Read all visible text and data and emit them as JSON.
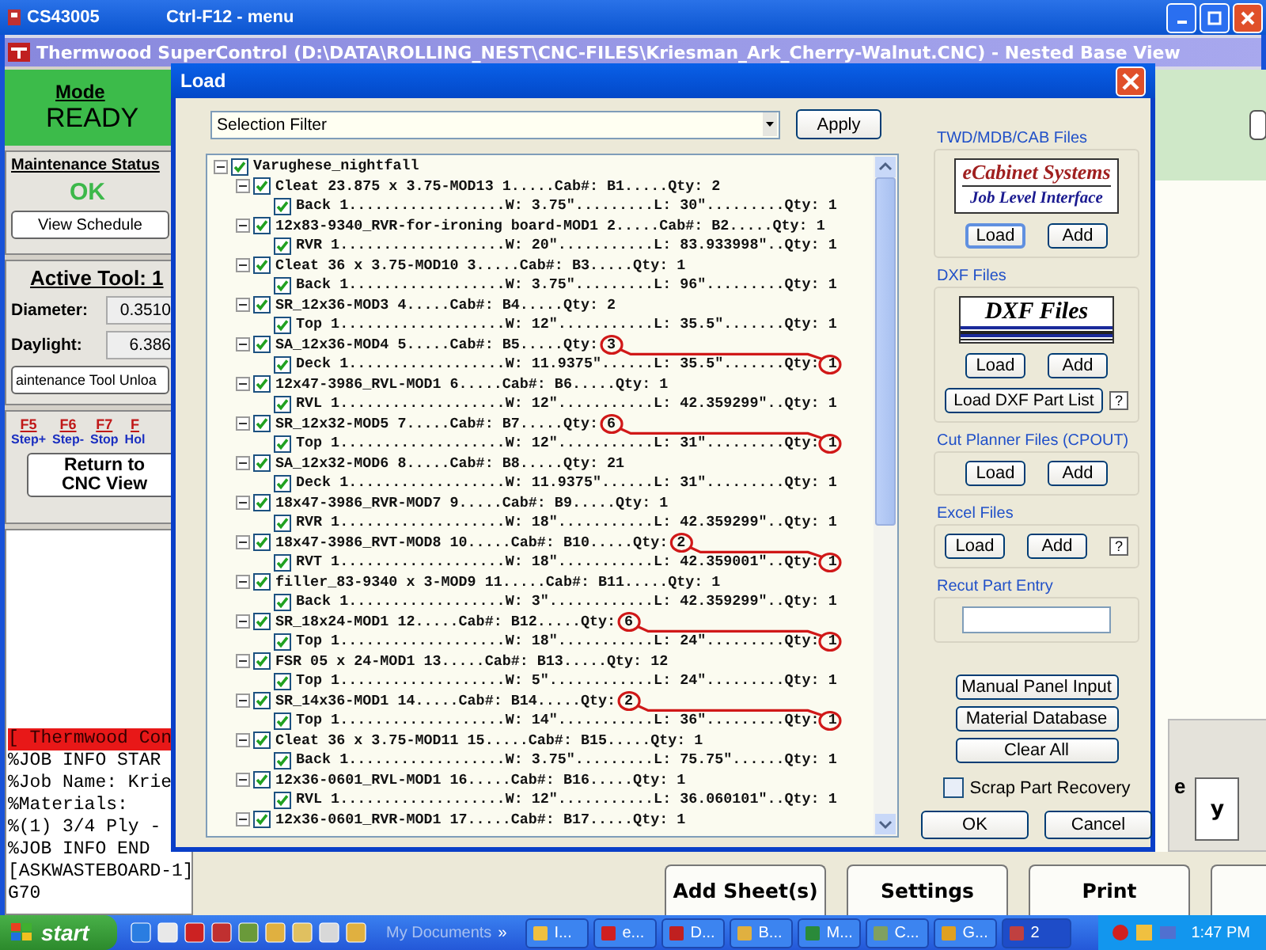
{
  "window": {
    "title": "CS43005",
    "menu_hint": "Ctrl-F12 - menu"
  },
  "app": {
    "title": "Thermwood SuperControl (D:\\DATA\\ROLLING_NEST\\CNC-FILES\\Kriesman_Ark_Cherry-Walnut.CNC) - Nested Base View"
  },
  "left_panel": {
    "mode_label": "Mode",
    "mode_value": "READY",
    "maintenance": {
      "label": "Maintenance Status",
      "status": "OK",
      "button": "View Schedule"
    },
    "tool": {
      "title": "Active Tool: 1",
      "fields": [
        {
          "label": "Diameter:",
          "value": "0.3510"
        },
        {
          "label": "Daylight:",
          "value": "6.386"
        }
      ],
      "button": "aintenance Tool Unloa"
    },
    "function_keys": [
      {
        "key": "F5",
        "action": "Step+"
      },
      {
        "key": "F6",
        "action": "Step-"
      },
      {
        "key": "F7",
        "action": "Stop"
      },
      {
        "key": "F",
        "action": "Hol"
      }
    ],
    "return_button": [
      "Return to",
      "CNC View"
    ],
    "code_lines": [
      {
        "text": "[ Thermwood Con",
        "highlighted": true
      },
      {
        "text": "%JOB INFO STAR",
        "highlighted": false
      },
      {
        "text": "%Job Name: Krie",
        "highlighted": false
      },
      {
        "text": "%Materials:",
        "highlighted": false
      },
      {
        "text": "%(1) 3/4 Ply -",
        "highlighted": false
      },
      {
        "text": "%JOB INFO END",
        "highlighted": false
      },
      {
        "text": "[ASKWASTEBOARD-1]",
        "highlighted": false
      },
      {
        "text": "G70",
        "highlighted": false
      }
    ]
  },
  "canvas": {
    "side_label": "e",
    "side_button": "y",
    "bottom_buttons": [
      "Add Sheet(s)",
      "Settings",
      "Print"
    ]
  },
  "dialog": {
    "title": "Load",
    "filter": {
      "value": "Selection Filter"
    },
    "apply_button": "Apply",
    "tree": {
      "label": "Varughese_nightfall",
      "checked": true,
      "expanded": true,
      "children": [
        {
          "label": "Cleat 23.875 x 3.75-MOD13 1.....Cab#: B1.....Qty: 2",
          "checked": true,
          "expanded": true,
          "circled": false,
          "children": [
            {
              "label": "Back 1..................W: 3.75\".........L: 30\".........Qty: 1",
              "checked": true
            }
          ]
        },
        {
          "label": "12x83-9340_RVR-for-ironing board-MOD1 2.....Cab#: B2.....Qty: 1",
          "checked": true,
          "expanded": true,
          "circled": false,
          "children": [
            {
              "label": "RVR 1...................W: 20\"...........L: 83.933998\"..Qty: 1",
              "checked": true
            }
          ]
        },
        {
          "label": "Cleat 36 x 3.75-MOD10 3.....Cab#: B3.....Qty: 1",
          "checked": true,
          "expanded": true,
          "circled": false,
          "children": [
            {
              "label": "Back 1..................W: 3.75\".........L: 96\".........Qty: 1",
              "checked": true
            }
          ]
        },
        {
          "label": "SR_12x36-MOD3 4.....Cab#: B4.....Qty: 2",
          "checked": true,
          "expanded": true,
          "circled": false,
          "children": [
            {
              "label": "Top 1...................W: 12\"...........L: 35.5\".......Qty: 1",
              "checked": true
            }
          ]
        },
        {
          "label": "SA_12x36-MOD4 5.....Cab#: B5.....Qty: 3",
          "checked": true,
          "expanded": true,
          "circled": true,
          "children": [
            {
              "label": "Deck 1..................W: 11.9375\"......L: 35.5\".......Qty: 1",
              "checked": true
            }
          ]
        },
        {
          "label": "12x47-3986_RVL-MOD1 6.....Cab#: B6.....Qty: 1",
          "checked": true,
          "expanded": true,
          "circled": false,
          "children": [
            {
              "label": "RVL 1...................W: 12\"...........L: 42.359299\"..Qty: 1",
              "checked": true
            }
          ]
        },
        {
          "label": "SR_12x32-MOD5 7.....Cab#: B7.....Qty: 6",
          "checked": true,
          "expanded": true,
          "circled": true,
          "children": [
            {
              "label": "Top 1...................W: 12\"...........L: 31\".........Qty: 1",
              "checked": true
            }
          ]
        },
        {
          "label": "SA_12x32-MOD6 8.....Cab#: B8.....Qty: 21",
          "checked": true,
          "expanded": true,
          "circled": false,
          "children": [
            {
              "label": "Deck 1..................W: 11.9375\"......L: 31\".........Qty: 1",
              "checked": true
            }
          ]
        },
        {
          "label": "18x47-3986_RVR-MOD7 9.....Cab#: B9.....Qty: 1",
          "checked": true,
          "expanded": true,
          "circled": false,
          "children": [
            {
              "label": "RVR 1...................W: 18\"...........L: 42.359299\"..Qty: 1",
              "checked": true
            }
          ]
        },
        {
          "label": "18x47-3986_RVT-MOD8 10.....Cab#: B10.....Qty: 2",
          "checked": true,
          "expanded": true,
          "circled": true,
          "children": [
            {
              "label": "RVT 1...................W: 18\"...........L: 42.359001\"..Qty: 1",
              "checked": true
            }
          ]
        },
        {
          "label": "filler_83-9340 x 3-MOD9 11.....Cab#: B11.....Qty: 1",
          "checked": true,
          "expanded": true,
          "circled": false,
          "children": [
            {
              "label": "Back 1..................W: 3\"............L: 42.359299\"..Qty: 1",
              "checked": true
            }
          ]
        },
        {
          "label": "SR_18x24-MOD1 12.....Cab#: B12.....Qty: 6",
          "checked": true,
          "expanded": true,
          "circled": true,
          "children": [
            {
              "label": "Top 1...................W: 18\"...........L: 24\".........Qty: 1",
              "checked": true
            }
          ]
        },
        {
          "label": "FSR 05 x 24-MOD1 13.....Cab#: B13.....Qty: 12",
          "checked": true,
          "expanded": true,
          "circled": false,
          "children": [
            {
              "label": "Top 1...................W: 5\"............L: 24\".........Qty: 1",
              "checked": true
            }
          ]
        },
        {
          "label": "SR_14x36-MOD1 14.....Cab#: B14.....Qty: 2",
          "checked": true,
          "expanded": true,
          "circled": true,
          "children": [
            {
              "label": "Top 1...................W: 14\"...........L: 36\".........Qty: 1",
              "checked": true
            }
          ]
        },
        {
          "label": "Cleat 36 x 3.75-MOD11 15.....Cab#: B15.....Qty: 1",
          "checked": true,
          "expanded": true,
          "circled": false,
          "children": [
            {
              "label": "Back 1..................W: 3.75\".........L: 75.75\"......Qty: 1",
              "checked": true
            }
          ]
        },
        {
          "label": "12x36-0601_RVL-MOD1 16.....Cab#: B16.....Qty: 1",
          "checked": true,
          "expanded": true,
          "circled": false,
          "children": [
            {
              "label": "RVL 1...................W: 12\"...........L: 36.060101\"..Qty: 1",
              "checked": true
            }
          ]
        },
        {
          "label": "12x36-0601_RVR-MOD1 17.....Cab#: B17.....Qty: 1",
          "checked": true,
          "expanded": true
        }
      ]
    },
    "side": {
      "twd": {
        "label": "TWD/MDB/CAB Files",
        "logo_title": "eCabinet Systems",
        "logo_subtitle": "Job Level Interface",
        "buttons": [
          "Load",
          "Add"
        ]
      },
      "dxf": {
        "label": "DXF Files",
        "logo_title": "DXF Files",
        "buttons": [
          "Load",
          "Add"
        ],
        "part_list_button": "Load DXF Part List",
        "help": "?"
      },
      "cpout": {
        "label": "Cut Planner Files (CPOUT)",
        "buttons": [
          "Load",
          "Add"
        ]
      },
      "excel": {
        "label": "Excel Files",
        "buttons": [
          "Load",
          "Add"
        ],
        "help": "?"
      },
      "recut": {
        "label": "Recut Part Entry"
      },
      "actions": [
        "Manual Panel Input",
        "Material Database",
        "Clear All"
      ],
      "scrap": {
        "label": "Scrap Part Recovery",
        "checked": false
      },
      "ok": "OK",
      "cancel": "Cancel"
    }
  },
  "taskbar": {
    "start": "start",
    "toolbar_label": "My Documents",
    "chevron": "»",
    "tasks": [
      "I...",
      "e...",
      "D...",
      "B...",
      "M...",
      "C...",
      "G...",
      "2"
    ],
    "clock": "1:47 PM"
  }
}
